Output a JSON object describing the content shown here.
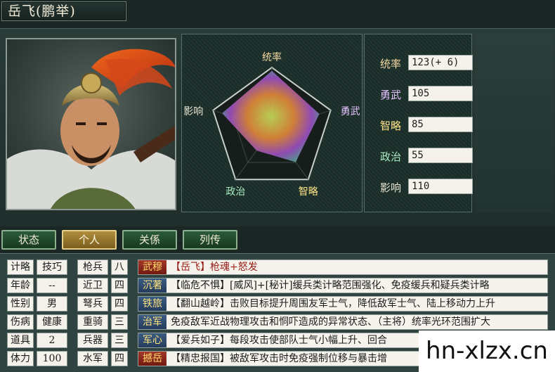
{
  "general": {
    "name": "岳飞(鹏举)"
  },
  "radar": {
    "labels": {
      "lead": "统率",
      "force": "勇武",
      "intel": "智略",
      "politics": "政治",
      "charm": "影响"
    },
    "values": {
      "lead": 123,
      "force": 105,
      "intel": 85,
      "politics": 55,
      "charm": 110
    },
    "max": 130
  },
  "stats": [
    {
      "label": "统率",
      "value": "123(+ 6)",
      "color": "#f4d9a2"
    },
    {
      "label": "勇武",
      "value": "105",
      "color": "#e6c2ff"
    },
    {
      "label": "智略",
      "value": "85",
      "color": "#ffe48a"
    },
    {
      "label": "政治",
      "value": "55",
      "color": "#a8ecc1"
    },
    {
      "label": "影响",
      "value": "110",
      "color": "#e8e4d2"
    }
  ],
  "tabs": [
    "状态",
    "个人",
    "关係",
    "列传"
  ],
  "active_tab": "个人",
  "personal": [
    {
      "label": "计略",
      "value": "技巧"
    },
    {
      "label": "年龄",
      "value": "--"
    },
    {
      "label": "性别",
      "value": "男"
    },
    {
      "label": "伤病",
      "value": "健康"
    },
    {
      "label": "道具",
      "value": "2"
    },
    {
      "label": "体力",
      "value": "100"
    }
  ],
  "troops": [
    {
      "label": "枪兵",
      "value": "八"
    },
    {
      "label": "近卫",
      "value": "四"
    },
    {
      "label": "弩兵",
      "value": "四"
    },
    {
      "label": "重骑",
      "value": "三"
    },
    {
      "label": "兵器",
      "value": "三"
    },
    {
      "label": "水军",
      "value": "四"
    }
  ],
  "skills": [
    {
      "name": "武穆",
      "desc": "【岳飞】枪魂+怒发"
    },
    {
      "name": "沉著",
      "desc": "【临危不惧】[威风]+[秘计]缓兵类计略范围强化、免疫缓兵和疑兵类计略"
    },
    {
      "name": "铁旅",
      "desc": "【翻山越岭】击败目标提升周围友军士气，降低敌军士气、陆上移动力上升"
    },
    {
      "name": "治军",
      "desc": "免疫敌军近战物理攻击和恫吓造成的异常状态、（主将）统率光环范围扩大"
    },
    {
      "name": "军心",
      "desc": "【爱兵如子】每段攻击使部队士气小幅上升、回合"
    },
    {
      "name": "撼岳",
      "desc": "【精忠报国】被敌军攻击时免疫强制位移与暴击增"
    }
  ],
  "watermark": "hn-xlzx.cn"
}
